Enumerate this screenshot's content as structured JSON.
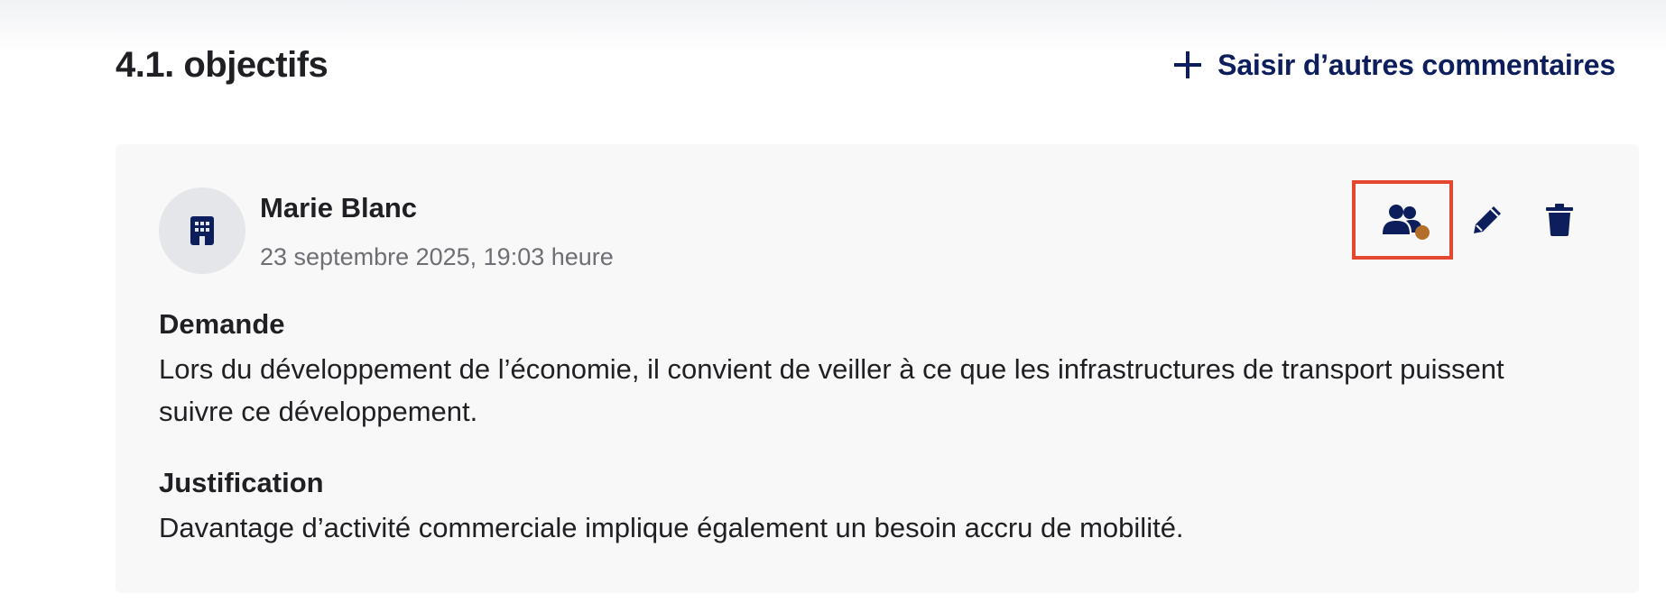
{
  "section": {
    "title": "4.1. objectifs",
    "add_comment_label": "Saisir d’autres commentaires"
  },
  "comment": {
    "author": "Marie Blanc",
    "date": "23 septembre 2025, 19:03 heure",
    "avatar_icon": "building-icon",
    "fields": [
      {
        "label": "Demande",
        "text": "Lors du développement de l’économie, il convient de veiller à ce que les infrastructures de transport puissent suivre ce développement."
      },
      {
        "label": "Justification",
        "text": "Davantage d’activité commerciale implique également un besoin accru de mobilité."
      }
    ],
    "actions": [
      {
        "name": "visibility-group",
        "icon": "users-icon"
      },
      {
        "name": "edit",
        "icon": "pencil-icon"
      },
      {
        "name": "delete",
        "icon": "trash-icon"
      }
    ]
  },
  "colors": {
    "accent": "#0d1e5c",
    "highlight": "#e4472f",
    "status_dot": "#b36f2a",
    "card_bg": "#f8f8f8",
    "avatar_bg": "#e5e6ea"
  }
}
